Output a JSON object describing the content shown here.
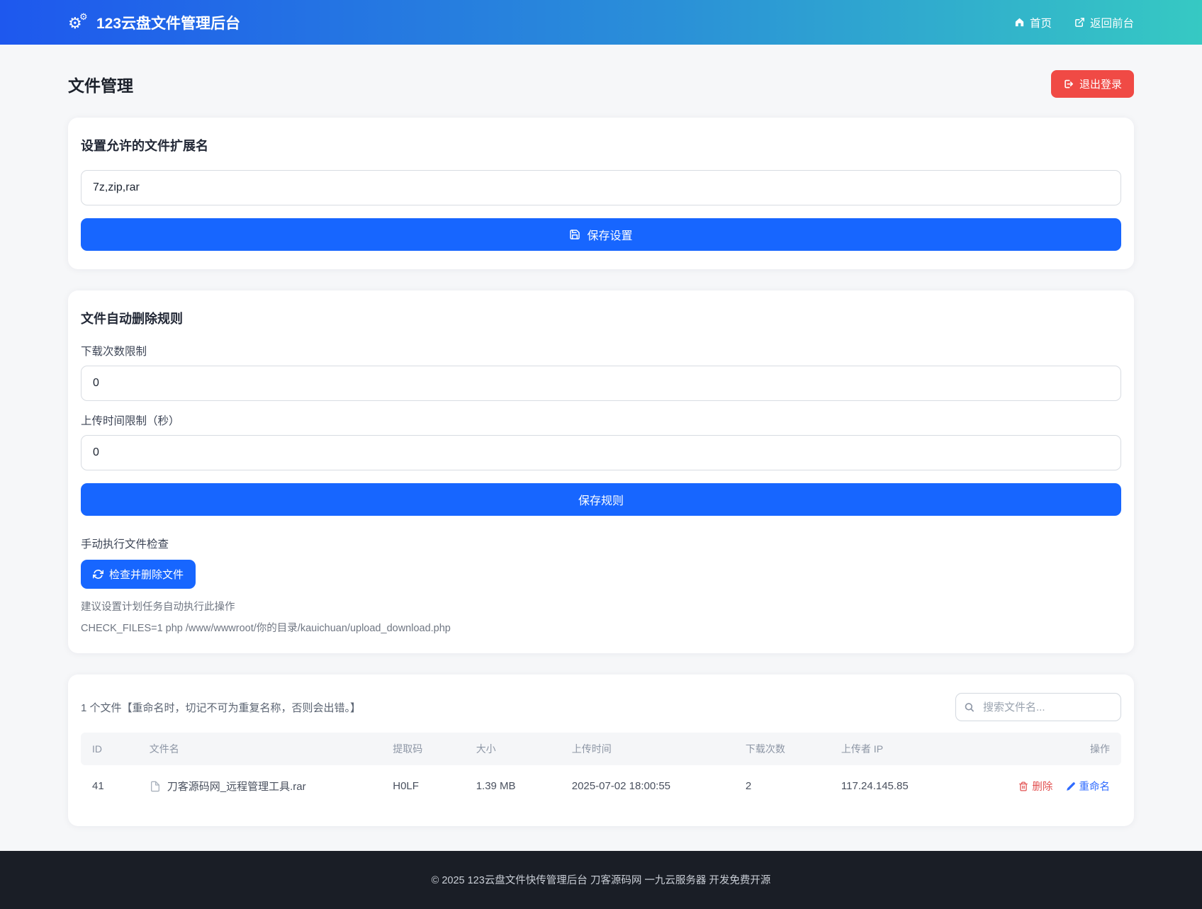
{
  "navbar": {
    "brand": "123云盘文件管理后台",
    "home_label": "首页",
    "front_label": "返回前台"
  },
  "page": {
    "title": "文件管理",
    "logout_label": "退出登录"
  },
  "extension_card": {
    "title": "设置允许的文件扩展名",
    "input_value": "7z,zip,rar",
    "save_label": "保存设置"
  },
  "rules_card": {
    "title": "文件自动删除规则",
    "download_limit_label": "下载次数限制",
    "download_limit_value": "0",
    "upload_time_label": "上传时间限制（秒）",
    "upload_time_value": "0",
    "save_label": "保存规则",
    "manual_check_label": "手动执行文件检查",
    "check_button_label": "检查并删除文件",
    "note1": "建议设置计划任务自动执行此操作",
    "note2": "CHECK_FILES=1 php /www/wwwroot/你的目录/kauichuan/upload_download.php"
  },
  "files_card": {
    "summary": "1 个文件【重命名时，切记不可为重复名称，否则会出错。】",
    "search_placeholder": "搜索文件名...",
    "table": {
      "headers": [
        "ID",
        "文件名",
        "提取码",
        "大小",
        "上传时间",
        "下载次数",
        "上传者 IP",
        "操作"
      ],
      "rows": [
        {
          "id": "41",
          "name": "刀客源码网_远程管理工具.rar",
          "code": "H0LF",
          "size": "1.39 MB",
          "uploaded": "2025-07-02 18:00:55",
          "downloads": "2",
          "ip": "117.24.145.85",
          "delete_label": "删除",
          "rename_label": "重命名"
        }
      ]
    }
  },
  "footer": {
    "text": "© 2025 123云盘文件快传管理后台  刀客源码网  一九云服务器 开发免费开源"
  },
  "colors": {
    "primary": "#1766ff",
    "danger": "#f04a45",
    "navbar_gradient_start": "#1e58ee",
    "navbar_gradient_end": "#36c9c3",
    "footer_bg": "#1a1e26"
  }
}
